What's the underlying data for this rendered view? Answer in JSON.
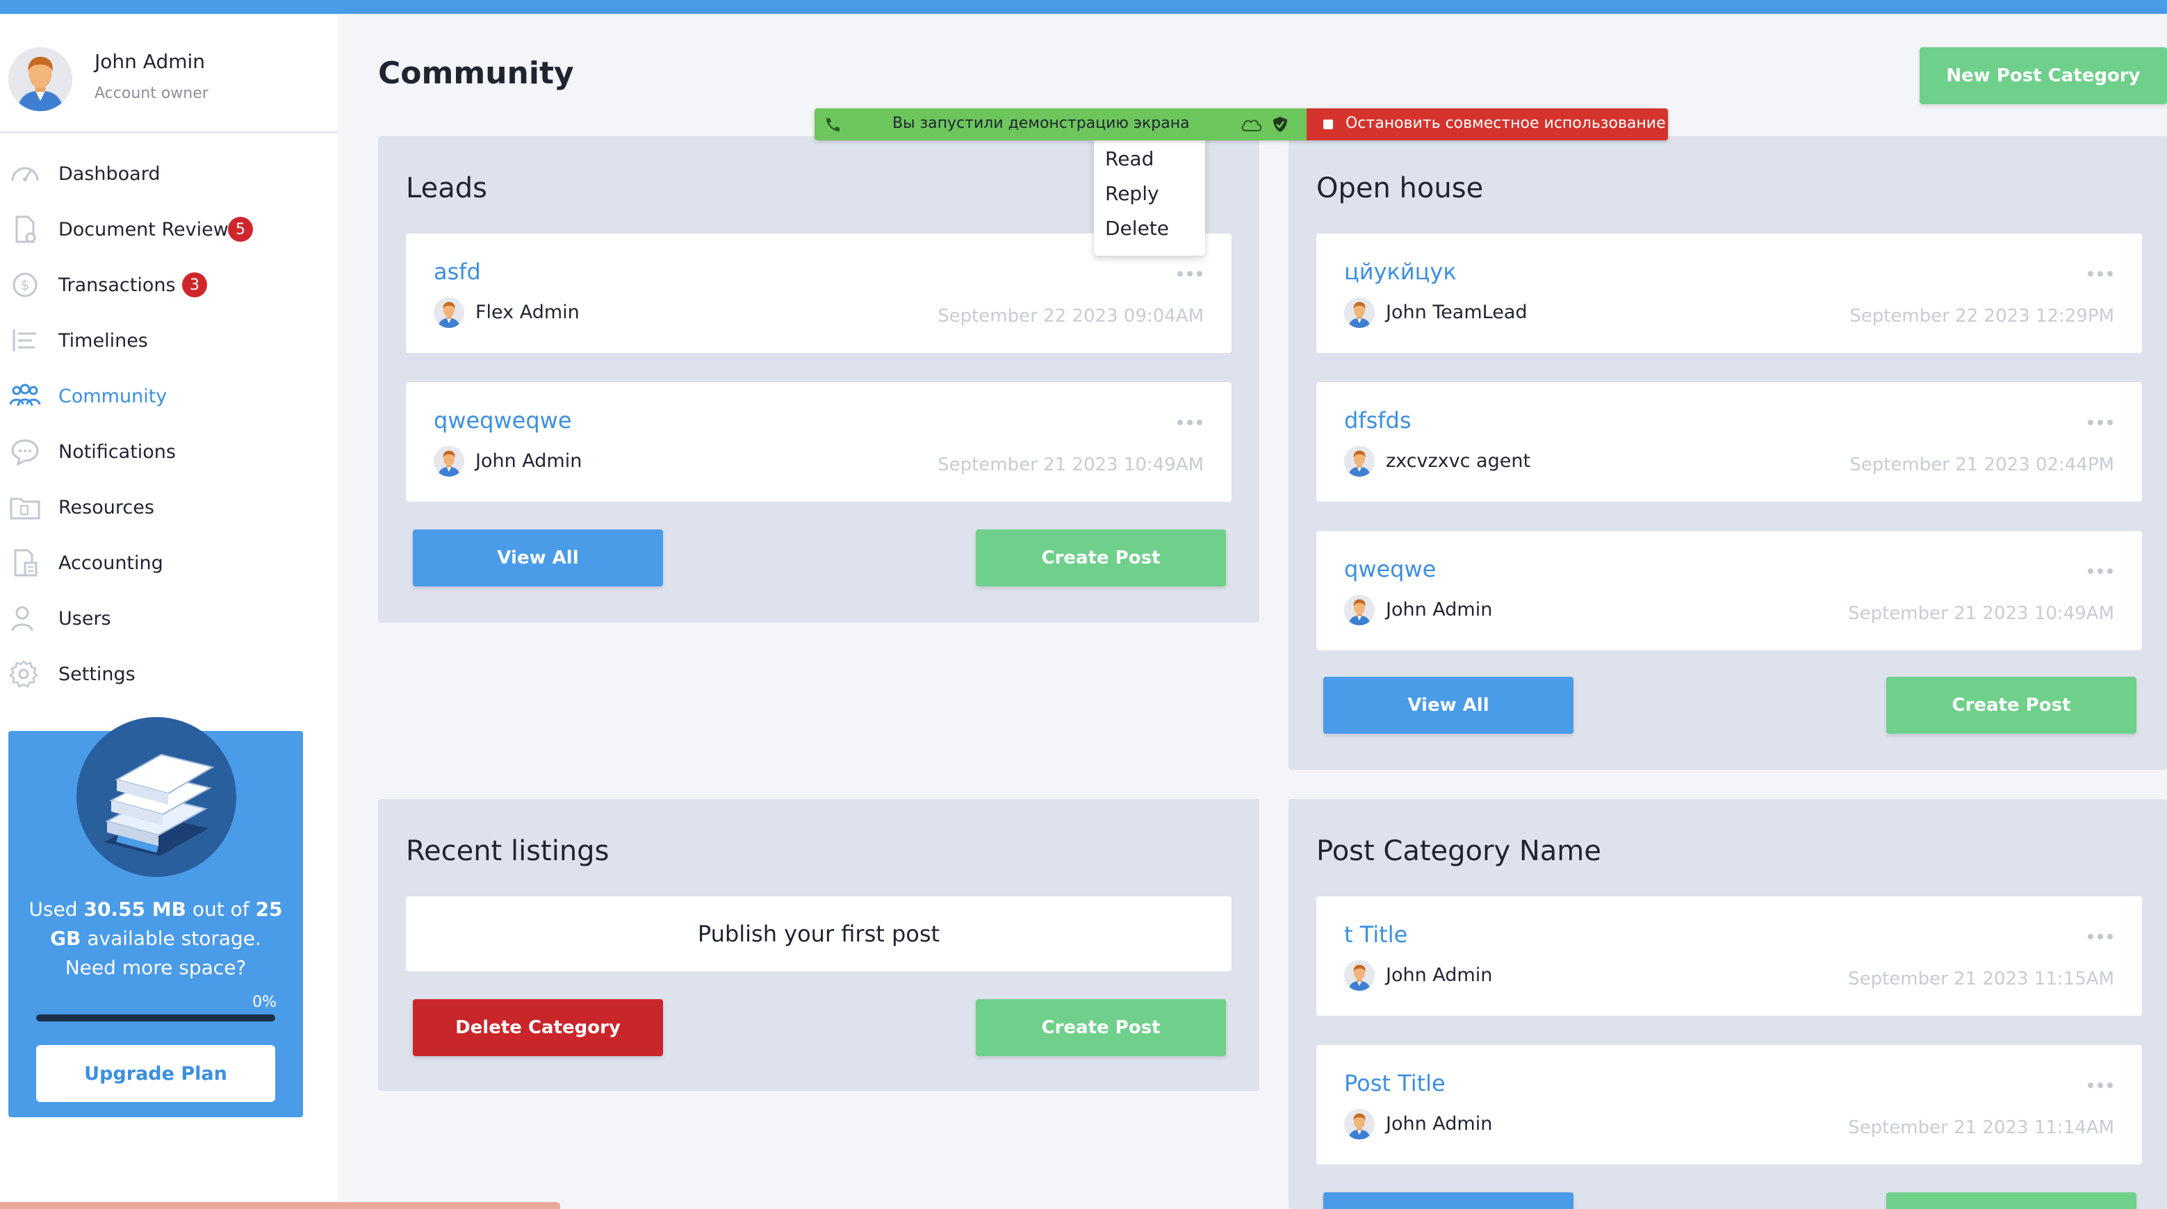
{
  "profile": {
    "name": "John Admin",
    "role": "Account owner"
  },
  "sidebar": {
    "items": [
      {
        "label": "Dashboard",
        "icon": "gauge-icon"
      },
      {
        "label": "Document Review",
        "icon": "document-icon",
        "badge": "5"
      },
      {
        "label": "Transactions",
        "icon": "dollar-icon",
        "badge": "3"
      },
      {
        "label": "Timelines",
        "icon": "timeline-icon"
      },
      {
        "label": "Community",
        "icon": "people-icon",
        "active": true
      },
      {
        "label": "Notifications",
        "icon": "chat-bubble-icon"
      },
      {
        "label": "Resources",
        "icon": "folder-icon"
      },
      {
        "label": "Accounting",
        "icon": "calculator-icon"
      },
      {
        "label": "Users",
        "icon": "user-icon"
      },
      {
        "label": "Settings",
        "icon": "gear-icon"
      }
    ]
  },
  "storage": {
    "text_used": "Used ",
    "used": "30.55 MB",
    "text_outof": " out of ",
    "total": "25 GB",
    "text_available": " available storage.",
    "text_more": "Need more space?",
    "percent_label": "0%",
    "percent": 0,
    "upgrade_label": "Upgrade Plan"
  },
  "page": {
    "title": "Community",
    "new_category_label": "New Post Category"
  },
  "screen_share": {
    "message": "Вы запустили демонстрацию экрана",
    "stop_label": "Остановить совместное использование"
  },
  "menu": {
    "items": [
      "Read",
      "Reply",
      "Delete"
    ]
  },
  "panels": {
    "leads": {
      "title": "Leads",
      "posts": [
        {
          "title": "asfd",
          "author": "Flex Admin",
          "date": "September 22 2023 09:04AM"
        },
        {
          "title": "qweqweqwe",
          "author": "John Admin",
          "date": "September 21 2023 10:49AM"
        }
      ],
      "view_all": "View All",
      "create_post": "Create Post"
    },
    "open_house": {
      "title": "Open house",
      "posts": [
        {
          "title": "цйукйцук",
          "author": "John TeamLead",
          "date": "September 22 2023 12:29PM"
        },
        {
          "title": "dfsfds",
          "author": "zxcvzxvc agent",
          "date": "September 21 2023 02:44PM"
        },
        {
          "title": "qweqwe",
          "author": "John Admin",
          "date": "September 21 2023 10:49AM"
        }
      ],
      "view_all": "View All",
      "create_post": "Create Post"
    },
    "recent_listings": {
      "title": "Recent listings",
      "empty_text": "Publish your first post",
      "delete_category": "Delete Category",
      "create_post": "Create Post"
    },
    "post_category": {
      "title": "Post Category Name",
      "posts": [
        {
          "title": "t Title",
          "author": "John Admin",
          "date": "September 21 2023 11:15AM"
        },
        {
          "title": "Post Title",
          "author": "John Admin",
          "date": "September 21 2023 11:14AM"
        }
      ]
    }
  },
  "colors": {
    "accent": "#4a9be8",
    "success": "#6fd08b",
    "danger": "#c9262b",
    "panel": "#dde2ec"
  }
}
